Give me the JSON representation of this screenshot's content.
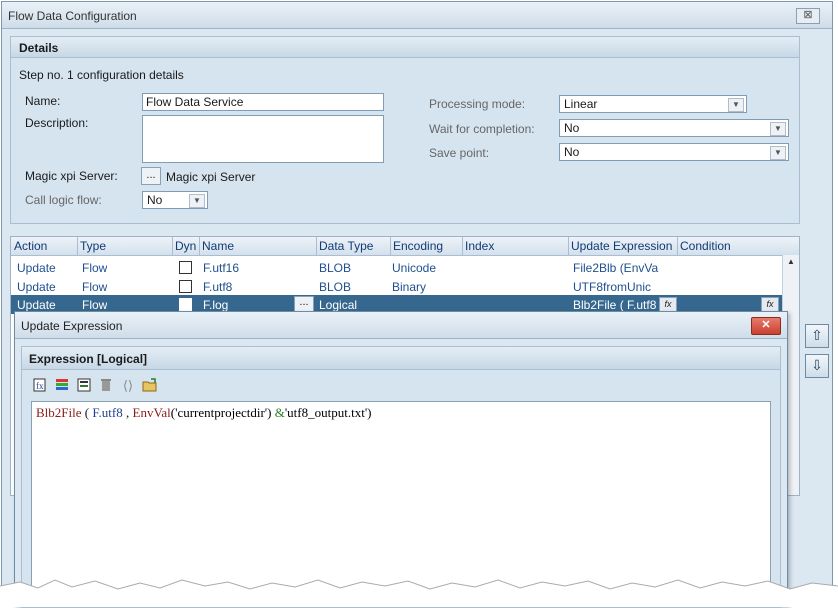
{
  "window": {
    "title": "Flow Data Configuration",
    "close_glyph": "⊠"
  },
  "details": {
    "header": "Details",
    "subtitle": "Step no. 1 configuration details",
    "name_label": "Name:",
    "name_value": "Flow Data Service",
    "description_label": "Description:",
    "description_value": "",
    "server_label": "Magic xpi Server:",
    "server_button": "...",
    "server_value": "Magic xpi Server",
    "call_logic_label": "Call logic flow:",
    "call_logic_value": "No",
    "processing_label": "Processing mode:",
    "processing_value": "Linear",
    "wait_label": "Wait for completion:",
    "wait_value": "No",
    "save_label": "Save point:",
    "save_value": "No"
  },
  "grid": {
    "columns": [
      "Action",
      "Type",
      "Dyn",
      "Name",
      "Data Type",
      "Encoding",
      "Index",
      "Update Expression",
      "Condition"
    ],
    "rows": [
      {
        "action": "Update",
        "type": "Flow",
        "name": "F.utf16",
        "data_type": "BLOB",
        "encoding": "Unicode",
        "index": "",
        "update_expression": "File2Blb (EnvVa",
        "condition": ""
      },
      {
        "action": "Update",
        "type": "Flow",
        "name": "F.utf8",
        "data_type": "BLOB",
        "encoding": "Binary",
        "index": "",
        "update_expression": "UTF8fromUnic",
        "condition": ""
      },
      {
        "action": "Update",
        "type": "Flow",
        "name": "F.log",
        "data_type": "Logical",
        "encoding": "",
        "index": "",
        "update_expression": "Blb2File ( F.utf8",
        "condition": ""
      }
    ],
    "dots": "...",
    "fx": "fx"
  },
  "dialog": {
    "title": "Update Expression",
    "close_glyph": "✕",
    "expr_header": "Expression [Logical]",
    "toolbar": [
      "expression-editor-icon",
      "function-list-icon",
      "variable-list-icon",
      "delete-icon",
      "brackets-icon",
      "open-file-icon"
    ],
    "expression": {
      "p1": "Blb2File",
      "p2": " ( ",
      "p3": "F.utf8",
      "p4": " , ",
      "p5": "EnvVal",
      "p6": "('currentprojectdir') ",
      "p7": "&",
      "p8": "'utf8_output.txt')"
    }
  },
  "side_buttons": {
    "up_glyph": "⇧",
    "down_glyph": "⇩"
  },
  "colors": {
    "selection": "#36688f",
    "panel": "#d6e4ef",
    "link_text": "#1f4f8f"
  }
}
